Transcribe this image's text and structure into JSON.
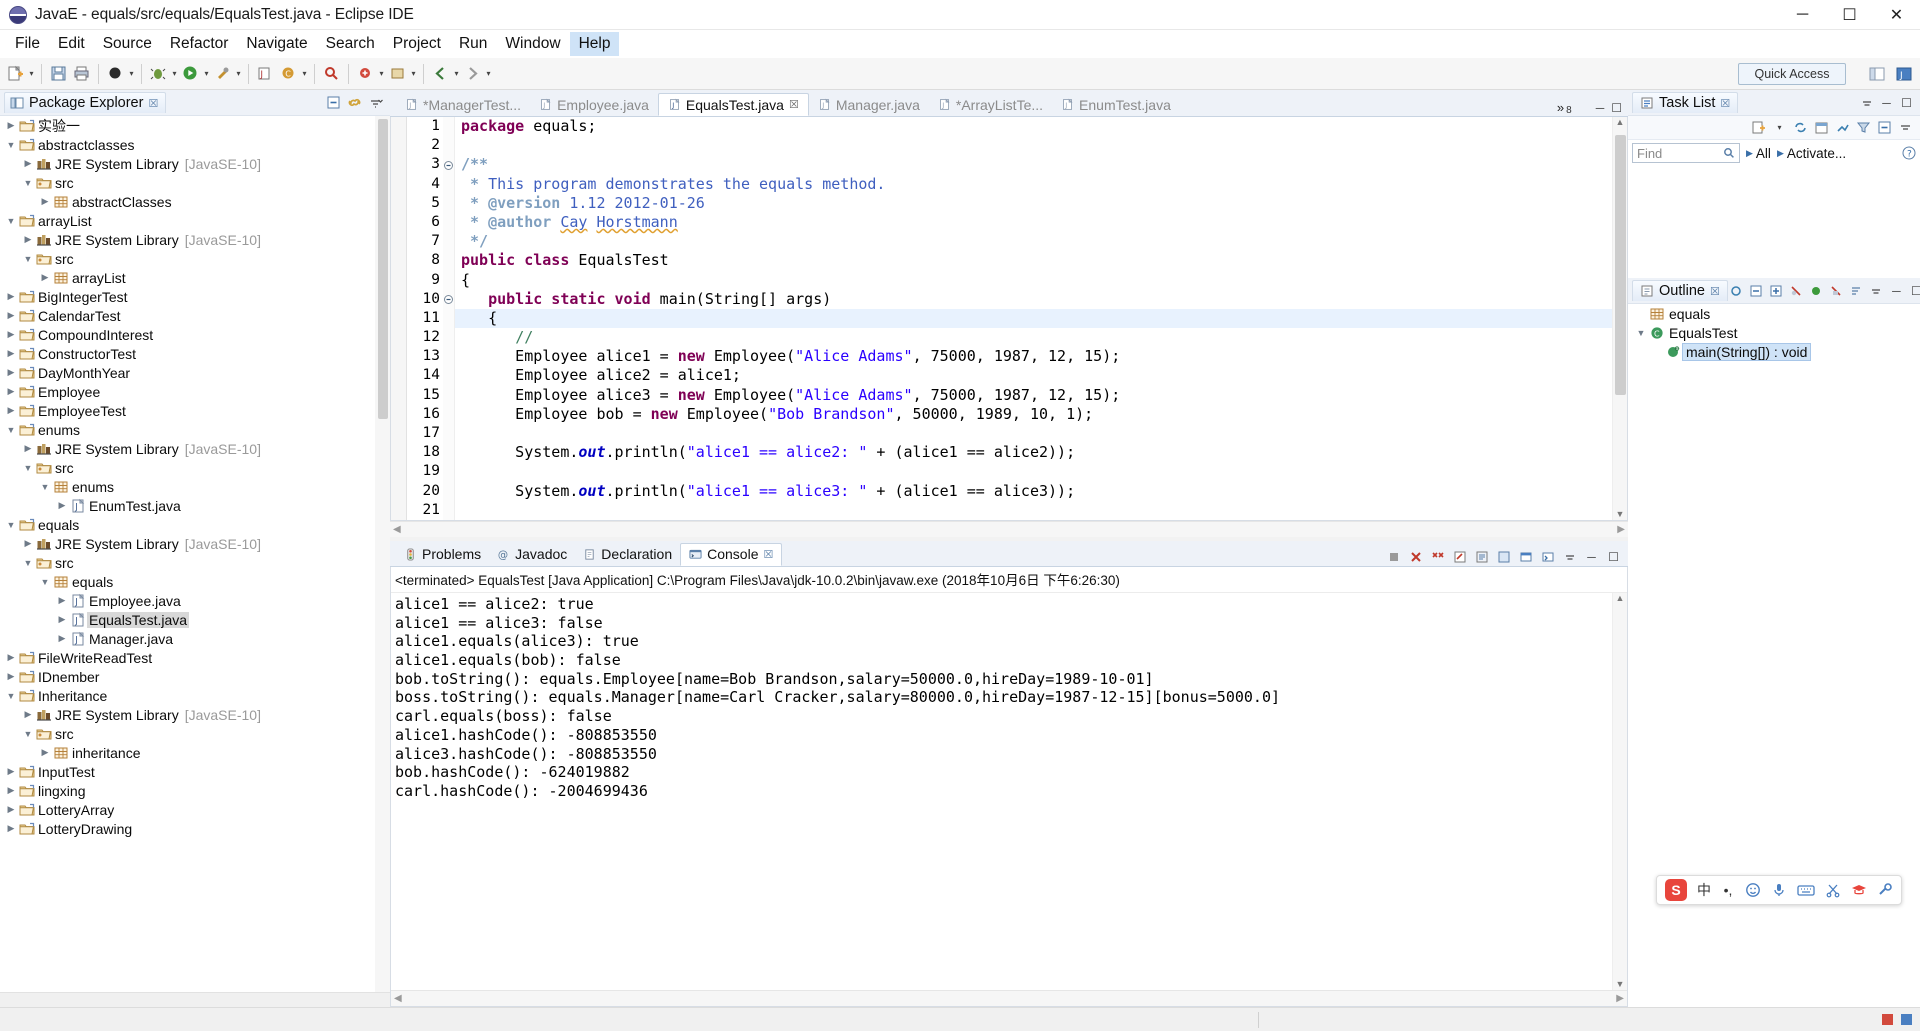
{
  "window": {
    "title": "JavaE - equals/src/equals/EqualsTest.java - Eclipse IDE",
    "minimize": "─",
    "maximize": "☐",
    "close": "✕"
  },
  "menubar": {
    "items": [
      {
        "label": "File",
        "selected": false
      },
      {
        "label": "Edit",
        "selected": false
      },
      {
        "label": "Source",
        "selected": false
      },
      {
        "label": "Refactor",
        "selected": false
      },
      {
        "label": "Navigate",
        "selected": false
      },
      {
        "label": "Search",
        "selected": false
      },
      {
        "label": "Project",
        "selected": false
      },
      {
        "label": "Run",
        "selected": false
      },
      {
        "label": "Window",
        "selected": false
      },
      {
        "label": "Help",
        "selected": true
      }
    ]
  },
  "toolbar": {
    "quick_access": "Quick Access",
    "icons": [
      "new-wizard-icon",
      "save-icon",
      "print-icon",
      "build-icon",
      "debug-icon",
      "run-icon",
      "run-external-tools-icon",
      "new-java-project-icon",
      "new-class-icon",
      "search-icon",
      "next-annotation-icon",
      "previous-annotation-icon",
      "back-icon",
      "forward-icon"
    ],
    "perspective_icons": [
      "open-perspective-icon",
      "java-perspective-icon"
    ]
  },
  "package_explorer": {
    "title": "Package Explorer",
    "close_label": "☒",
    "view_icons": [
      "collapse-all-icon",
      "link-with-editor-icon",
      "view-menu-icon"
    ],
    "tree": [
      {
        "depth": 0,
        "twist": "collapsed",
        "icon": "project-icon",
        "label": "实验一",
        "suffix": "",
        "selected": false
      },
      {
        "depth": 0,
        "twist": "expanded",
        "icon": "project-icon",
        "label": "abstractclasses",
        "suffix": "",
        "selected": false
      },
      {
        "depth": 1,
        "twist": "collapsed",
        "icon": "library-icon",
        "label": "JRE System Library",
        "suffix": "[JavaSE-10]",
        "selected": false
      },
      {
        "depth": 1,
        "twist": "expanded",
        "icon": "srcfolder-icon",
        "label": "src",
        "suffix": "",
        "selected": false
      },
      {
        "depth": 2,
        "twist": "collapsed",
        "icon": "package-icon",
        "label": "abstractClasses",
        "suffix": "",
        "selected": false
      },
      {
        "depth": 0,
        "twist": "expanded",
        "icon": "project-icon",
        "label": "arrayList",
        "suffix": "",
        "selected": false
      },
      {
        "depth": 1,
        "twist": "collapsed",
        "icon": "library-icon",
        "label": "JRE System Library",
        "suffix": "[JavaSE-10]",
        "selected": false
      },
      {
        "depth": 1,
        "twist": "expanded",
        "icon": "srcfolder-icon",
        "label": "src",
        "suffix": "",
        "selected": false
      },
      {
        "depth": 2,
        "twist": "collapsed",
        "icon": "package-icon",
        "label": "arrayList",
        "suffix": "",
        "selected": false
      },
      {
        "depth": 0,
        "twist": "collapsed",
        "icon": "project-icon",
        "label": "BigIntegerTest",
        "suffix": "",
        "selected": false
      },
      {
        "depth": 0,
        "twist": "collapsed",
        "icon": "project-icon",
        "label": "CalendarTest",
        "suffix": "",
        "selected": false
      },
      {
        "depth": 0,
        "twist": "collapsed",
        "icon": "project-icon",
        "label": "CompoundInterest",
        "suffix": "",
        "selected": false
      },
      {
        "depth": 0,
        "twist": "collapsed",
        "icon": "project-icon",
        "label": "ConstructorTest",
        "suffix": "",
        "selected": false
      },
      {
        "depth": 0,
        "twist": "collapsed",
        "icon": "project-icon",
        "label": "DayMonthYear",
        "suffix": "",
        "selected": false
      },
      {
        "depth": 0,
        "twist": "collapsed",
        "icon": "project-icon",
        "label": "Employee",
        "suffix": "",
        "selected": false
      },
      {
        "depth": 0,
        "twist": "collapsed",
        "icon": "project-icon",
        "label": "EmployeeTest",
        "suffix": "",
        "selected": false
      },
      {
        "depth": 0,
        "twist": "expanded",
        "icon": "project-icon",
        "label": "enums",
        "suffix": "",
        "selected": false
      },
      {
        "depth": 1,
        "twist": "collapsed",
        "icon": "library-icon",
        "label": "JRE System Library",
        "suffix": "[JavaSE-10]",
        "selected": false
      },
      {
        "depth": 1,
        "twist": "expanded",
        "icon": "srcfolder-icon",
        "label": "src",
        "suffix": "",
        "selected": false
      },
      {
        "depth": 2,
        "twist": "expanded",
        "icon": "package-icon",
        "label": "enums",
        "suffix": "",
        "selected": false
      },
      {
        "depth": 3,
        "twist": "collapsed",
        "icon": "javafile-icon",
        "label": "EnumTest.java",
        "suffix": "",
        "selected": false
      },
      {
        "depth": 0,
        "twist": "expanded",
        "icon": "project-icon",
        "label": "equals",
        "suffix": "",
        "selected": false
      },
      {
        "depth": 1,
        "twist": "collapsed",
        "icon": "library-icon",
        "label": "JRE System Library",
        "suffix": "[JavaSE-10]",
        "selected": false
      },
      {
        "depth": 1,
        "twist": "expanded",
        "icon": "srcfolder-icon",
        "label": "src",
        "suffix": "",
        "selected": false
      },
      {
        "depth": 2,
        "twist": "expanded",
        "icon": "package-icon",
        "label": "equals",
        "suffix": "",
        "selected": false
      },
      {
        "depth": 3,
        "twist": "collapsed",
        "icon": "javafile-icon",
        "label": "Employee.java",
        "suffix": "",
        "selected": false
      },
      {
        "depth": 3,
        "twist": "collapsed",
        "icon": "javafile-icon",
        "label": "EqualsTest.java",
        "suffix": "",
        "selected": true
      },
      {
        "depth": 3,
        "twist": "collapsed",
        "icon": "javafile-icon",
        "label": "Manager.java",
        "suffix": "",
        "selected": false
      },
      {
        "depth": 0,
        "twist": "collapsed",
        "icon": "project-icon",
        "label": "FileWriteReadTest",
        "suffix": "",
        "selected": false
      },
      {
        "depth": 0,
        "twist": "collapsed",
        "icon": "project-icon",
        "label": "IDnember",
        "suffix": "",
        "selected": false
      },
      {
        "depth": 0,
        "twist": "expanded",
        "icon": "project-icon",
        "label": "Inheritance",
        "suffix": "",
        "selected": false
      },
      {
        "depth": 1,
        "twist": "collapsed",
        "icon": "library-icon",
        "label": "JRE System Library",
        "suffix": "[JavaSE-10]",
        "selected": false
      },
      {
        "depth": 1,
        "twist": "expanded",
        "icon": "srcfolder-icon",
        "label": "src",
        "suffix": "",
        "selected": false
      },
      {
        "depth": 2,
        "twist": "collapsed",
        "icon": "package-icon",
        "label": "inheritance",
        "suffix": "",
        "selected": false
      },
      {
        "depth": 0,
        "twist": "collapsed",
        "icon": "project-icon",
        "label": "InputTest",
        "suffix": "",
        "selected": false
      },
      {
        "depth": 0,
        "twist": "collapsed",
        "icon": "project-icon",
        "label": "lingxing",
        "suffix": "",
        "selected": false
      },
      {
        "depth": 0,
        "twist": "collapsed",
        "icon": "project-icon",
        "label": "LotteryArray",
        "suffix": "",
        "selected": false
      },
      {
        "depth": 0,
        "twist": "collapsed",
        "icon": "project-icon",
        "label": "LotteryDrawing",
        "suffix": "",
        "selected": false
      }
    ]
  },
  "editor": {
    "tabs": [
      {
        "label": "*ManagerTest...",
        "active": false,
        "dirty": true
      },
      {
        "label": "Employee.java",
        "active": false,
        "dirty": false
      },
      {
        "label": "EqualsTest.java",
        "active": true,
        "dirty": false
      },
      {
        "label": "Manager.java",
        "active": false,
        "dirty": false
      },
      {
        "label": "*ArrayListTe...",
        "active": false,
        "dirty": true
      },
      {
        "label": "EnumTest.java",
        "active": false,
        "dirty": false
      }
    ],
    "overflow_label": "»",
    "overflow_count": "8",
    "minimize": "─",
    "maximize": "☐",
    "line_numbers": [
      "1",
      "2",
      "3",
      "4",
      "5",
      "6",
      "7",
      "8",
      "9",
      "10",
      "11",
      "12",
      "13",
      "14",
      "15",
      "16",
      "17",
      "18",
      "19",
      "20",
      "21"
    ],
    "code_lines": [
      {
        "n": "1",
        "fold": "",
        "html": "<span class=\"k\">package</span> equals;",
        "highlight": false
      },
      {
        "n": "2",
        "fold": "",
        "html": "",
        "highlight": false
      },
      {
        "n": "3",
        "fold": "-",
        "html": "<span class=\"jdt\">/**</span>",
        "highlight": false
      },
      {
        "n": "4",
        "fold": "",
        "html": " <span class=\"jdt\">*</span> <span class=\"jd\">This program demonstrates the equals method.</span>",
        "highlight": false
      },
      {
        "n": "5",
        "fold": "",
        "html": " <span class=\"jdt\">*</span> <span class=\"jdt\">@version</span> <span class=\"jd\">1.12 2012-01-26</span>",
        "highlight": false
      },
      {
        "n": "6",
        "fold": "",
        "html": " <span class=\"jdt\">*</span> <span class=\"jdt\">@author</span> <span class=\"jd wav\">Cay</span> <span class=\"jd wav\">Horstmann</span>",
        "highlight": false
      },
      {
        "n": "7",
        "fold": "",
        "html": " <span class=\"jdt\">*/</span>",
        "highlight": false
      },
      {
        "n": "8",
        "fold": "",
        "html": "<span class=\"k\">public class</span> EqualsTest",
        "highlight": false
      },
      {
        "n": "9",
        "fold": "",
        "html": "{",
        "highlight": false
      },
      {
        "n": "10",
        "fold": "-",
        "html": "   <span class=\"k\">public static void</span> main(String[] args)",
        "highlight": false
      },
      {
        "n": "11",
        "fold": "",
        "html": "   {",
        "highlight": true
      },
      {
        "n": "12",
        "fold": "",
        "html": "      <span class=\"cm\">//</span>",
        "highlight": false
      },
      {
        "n": "13",
        "fold": "",
        "html": "      Employee alice1 = <span class=\"k\">new</span> Employee(<span class=\"s\">\"Alice Adams\"</span>, 75000, 1987, 12, 15);",
        "highlight": false
      },
      {
        "n": "14",
        "fold": "",
        "html": "      Employee alice2 = alice1;",
        "highlight": false
      },
      {
        "n": "15",
        "fold": "",
        "html": "      Employee alice3 = <span class=\"k\">new</span> Employee(<span class=\"s\">\"Alice Adams\"</span>, 75000, 1987, 12, 15);",
        "highlight": false
      },
      {
        "n": "16",
        "fold": "",
        "html": "      Employee bob = <span class=\"k\">new</span> Employee(<span class=\"s\">\"Bob Brandson\"</span>, 50000, 1989, 10, 1);",
        "highlight": false
      },
      {
        "n": "17",
        "fold": "",
        "html": "",
        "highlight": false
      },
      {
        "n": "18",
        "fold": "",
        "html": "      System.<span class=\"fld\">out</span>.println(<span class=\"s\">\"alice1 == alice2: \"</span> + (alice1 == alice2));",
        "highlight": false
      },
      {
        "n": "19",
        "fold": "",
        "html": "",
        "highlight": false
      },
      {
        "n": "20",
        "fold": "",
        "html": "      System.<span class=\"fld\">out</span>.println(<span class=\"s\">\"alice1 == alice3: \"</span> + (alice1 == alice3));",
        "highlight": false
      },
      {
        "n": "21",
        "fold": "",
        "html": "",
        "highlight": false
      }
    ]
  },
  "console": {
    "tabs": [
      {
        "label": "Problems",
        "icon": "problems-icon",
        "active": false
      },
      {
        "label": "Javadoc",
        "icon": "javadoc-icon",
        "active": false
      },
      {
        "label": "Declaration",
        "icon": "declaration-icon",
        "active": false
      },
      {
        "label": "Console",
        "icon": "console-icon",
        "active": true
      }
    ],
    "close_label": "☒",
    "toolbar_icons": [
      "terminate-icon",
      "remove-launch-icon",
      "remove-all-icon",
      "clear-console-icon",
      "scroll-lock-icon",
      "pin-console-icon",
      "display-selected-console-icon",
      "open-console-icon",
      "view-menu-icon",
      "minimize-icon",
      "maximize-icon"
    ],
    "launch_line": "<terminated> EqualsTest [Java Application] C:\\Program Files\\Java\\jdk-10.0.2\\bin\\javaw.exe (2018年10月6日 下午6:26:30)",
    "output": [
      "alice1 == alice2: true",
      "alice1 == alice3: false",
      "alice1.equals(alice3): true",
      "alice1.equals(bob): false",
      "bob.toString(): equals.Employee[name=Bob Brandson,salary=50000.0,hireDay=1989-10-01]",
      "boss.toString(): equals.Manager[name=Carl Cracker,salary=80000.0,hireDay=1987-12-15][bonus=5000.0]",
      "carl.equals(boss): false",
      "alice1.hashCode(): -808853550",
      "alice3.hashCode(): -808853550",
      "bob.hashCode(): -624019882",
      "carl.hashCode(): -2004699436"
    ]
  },
  "task_list": {
    "title": "Task List",
    "close_label": "☒",
    "header_icons": [
      "new-task-icon",
      "categorize-icon",
      "view-menu-icon",
      "minimize-icon",
      "maximize-icon"
    ],
    "toolbar_icons": [
      "new-task-icon",
      "synchronize-icon",
      "schedule-icon",
      "focus-icon",
      "filter-icon",
      "collapse-all-icon",
      "view-menu-icon"
    ],
    "find_placeholder": "Find",
    "find_value": "",
    "find_icon": "search-icon",
    "all_label": "All",
    "activate_label": "Activate...",
    "help_icon": "help-icon"
  },
  "outline": {
    "title": "Outline",
    "close_label": "☒",
    "toolbar_icons": [
      "focus-on-active-task-icon",
      "collapse-all-icon",
      "expand-all-icon",
      "hide-fields-icon",
      "hide-static-icon",
      "hide-nonpublic-icon",
      "sort-icon",
      "view-menu-icon",
      "minimize-icon",
      "maximize-icon"
    ],
    "items": [
      {
        "depth": 0,
        "twist": "",
        "icon": "package-icon",
        "label": "equals",
        "selected": false
      },
      {
        "depth": 0,
        "twist": "expanded",
        "icon": "class-icon",
        "label": "EqualsTest",
        "selected": false
      },
      {
        "depth": 1,
        "twist": "",
        "icon": "method-icon",
        "label": "main(String[]) : void",
        "selected": true
      }
    ]
  },
  "ime_bar": {
    "logo": "S",
    "items": [
      "中",
      "•,",
      "smiley-icon",
      "mic-icon",
      "keyboard-icon",
      "scissors-icon",
      "hat-icon",
      "wrench-icon"
    ]
  },
  "statusbar": {
    "right_icons": [
      "writable-icon",
      "smart-insert-icon"
    ]
  }
}
